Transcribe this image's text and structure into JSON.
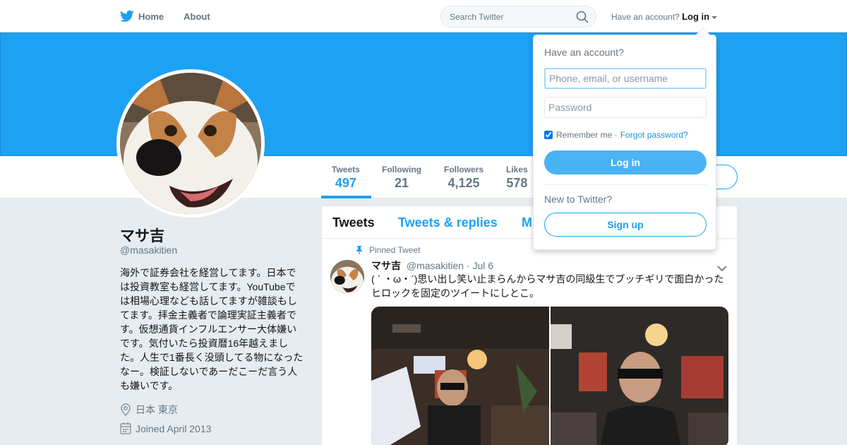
{
  "nav": {
    "home_label": "Home",
    "about_label": "About",
    "search_placeholder": "Search Twitter",
    "have_account_text": "Have an account?",
    "login_label": "Log in"
  },
  "profile": {
    "name": "マサ吉",
    "handle": "@masakitien",
    "bio": "海外で証券会社を経営してます。日本では投資教室も経営してます。YouTubeでは相場心理なども話してますが雑談もしてます。拝金主義者で論理実証主義者です。仮想通貨インフルエンサー大体嫌いです。気付いたら投資暦16年越えました。人生で1番長く没頭してる物になったなー。検証しないであーだこーだ言う人も嫌いです。",
    "location": "日本 東京",
    "joined": "Joined April 2013"
  },
  "stats": [
    {
      "label": "Tweets",
      "value": "497"
    },
    {
      "label": "Following",
      "value": "21"
    },
    {
      "label": "Followers",
      "value": "4,125"
    },
    {
      "label": "Likes",
      "value": "578"
    }
  ],
  "timeline": {
    "tabs": [
      "Tweets",
      "Tweets & replies",
      "M"
    ],
    "pinned_label": "Pinned Tweet",
    "tweet": {
      "name": "マサ吉",
      "handle": "@masakitien",
      "date": "· Jul 6",
      "text": "( ˋ ・ω・ˊ)思い出し笑い止まらんからマサ吉の同級生でブッチギリで面白かったヒロックを固定のツイートにしとこ。"
    }
  },
  "login_dropdown": {
    "title": "Have an account?",
    "username_placeholder": "Phone, email, or username",
    "password_placeholder": "Password",
    "remember_label": "Remember me ·",
    "forgot_label": "Forgot password?",
    "login_button": "Log in",
    "new_label": "New to Twitter?",
    "signup_button": "Sign up"
  },
  "colors": {
    "brand": "#1da1f2",
    "background": "#e6ecf0"
  }
}
